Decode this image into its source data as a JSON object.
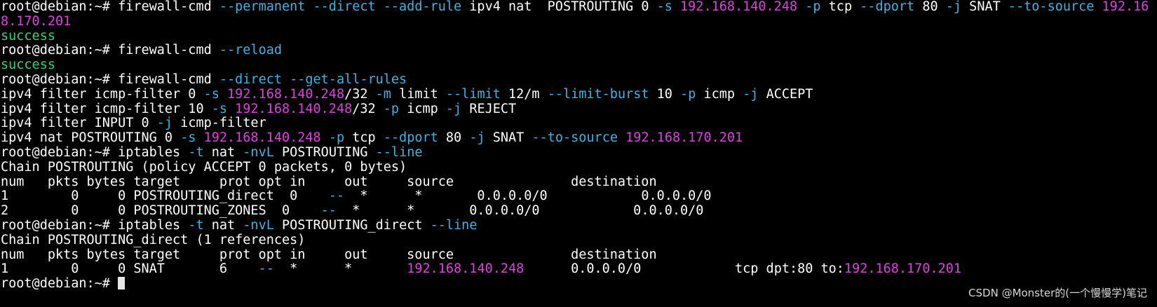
{
  "colors": {
    "background": "#000000",
    "text": "#ffffff",
    "option_flag": "#3cb4e6",
    "ip_address": "#e040e0",
    "success": "#2bd67b",
    "cursor": "#e6e6e6"
  },
  "terminal": {
    "lines": [
      {
        "kind": "command",
        "segments": [
          {
            "t": "root@debian:~# firewall-cmd ",
            "c": "n"
          },
          {
            "t": "--permanent --direct --add-rule",
            "c": "f"
          },
          {
            "t": " ipv4 nat  POSTROUTING 0 ",
            "c": "n"
          },
          {
            "t": "-s",
            "c": "f"
          },
          {
            "t": " ",
            "c": "n"
          },
          {
            "t": "192.168.140.248",
            "c": "i"
          },
          {
            "t": " ",
            "c": "n"
          },
          {
            "t": "-p",
            "c": "f"
          },
          {
            "t": " tcp ",
            "c": "n"
          },
          {
            "t": "--dport",
            "c": "f"
          },
          {
            "t": " 80 ",
            "c": "n"
          },
          {
            "t": "-j",
            "c": "f"
          },
          {
            "t": " SNAT ",
            "c": "n"
          },
          {
            "t": "--to-source",
            "c": "f"
          },
          {
            "t": " ",
            "c": "n"
          },
          {
            "t": "192.16",
            "c": "i"
          }
        ]
      },
      {
        "kind": "wrap",
        "segments": [
          {
            "t": "8.170.201",
            "c": "i"
          }
        ]
      },
      {
        "kind": "output",
        "segments": [
          {
            "t": "success",
            "c": "s"
          }
        ]
      },
      {
        "kind": "command",
        "segments": [
          {
            "t": "root@debian:~# firewall-cmd ",
            "c": "n"
          },
          {
            "t": "--reload",
            "c": "f"
          }
        ]
      },
      {
        "kind": "output",
        "segments": [
          {
            "t": "success",
            "c": "s"
          }
        ]
      },
      {
        "kind": "command",
        "segments": [
          {
            "t": "root@debian:~# firewall-cmd ",
            "c": "n"
          },
          {
            "t": "--direct --get-all-rules",
            "c": "f"
          }
        ]
      },
      {
        "kind": "output",
        "segments": [
          {
            "t": "ipv4 filter icmp-filter 0 ",
            "c": "n"
          },
          {
            "t": "-s",
            "c": "f"
          },
          {
            "t": " ",
            "c": "n"
          },
          {
            "t": "192.168.140.248",
            "c": "i"
          },
          {
            "t": "/32 ",
            "c": "n"
          },
          {
            "t": "-m",
            "c": "f"
          },
          {
            "t": " limit ",
            "c": "n"
          },
          {
            "t": "--limit",
            "c": "f"
          },
          {
            "t": " 12/m ",
            "c": "n"
          },
          {
            "t": "--limit-burst",
            "c": "f"
          },
          {
            "t": " 10 ",
            "c": "n"
          },
          {
            "t": "-p",
            "c": "f"
          },
          {
            "t": " icmp ",
            "c": "n"
          },
          {
            "t": "-j",
            "c": "f"
          },
          {
            "t": " ACCEPT",
            "c": "n"
          }
        ]
      },
      {
        "kind": "output",
        "segments": [
          {
            "t": "ipv4 filter icmp-filter 10 ",
            "c": "n"
          },
          {
            "t": "-s",
            "c": "f"
          },
          {
            "t": " ",
            "c": "n"
          },
          {
            "t": "192.168.140.248",
            "c": "i"
          },
          {
            "t": "/32 ",
            "c": "n"
          },
          {
            "t": "-p",
            "c": "f"
          },
          {
            "t": " icmp ",
            "c": "n"
          },
          {
            "t": "-j",
            "c": "f"
          },
          {
            "t": " REJECT",
            "c": "n"
          }
        ]
      },
      {
        "kind": "output",
        "segments": [
          {
            "t": "ipv4 filter INPUT 0 ",
            "c": "n"
          },
          {
            "t": "-j",
            "c": "f"
          },
          {
            "t": " icmp-filter",
            "c": "n"
          }
        ]
      },
      {
        "kind": "output",
        "segments": [
          {
            "t": "ipv4 nat POSTROUTING 0 ",
            "c": "n"
          },
          {
            "t": "-s",
            "c": "f"
          },
          {
            "t": " ",
            "c": "n"
          },
          {
            "t": "192.168.140.248",
            "c": "i"
          },
          {
            "t": " ",
            "c": "n"
          },
          {
            "t": "-p",
            "c": "f"
          },
          {
            "t": " tcp ",
            "c": "n"
          },
          {
            "t": "--dport",
            "c": "f"
          },
          {
            "t": " 80 ",
            "c": "n"
          },
          {
            "t": "-j",
            "c": "f"
          },
          {
            "t": " SNAT ",
            "c": "n"
          },
          {
            "t": "--to-source",
            "c": "f"
          },
          {
            "t": " ",
            "c": "n"
          },
          {
            "t": "192.168.170.201",
            "c": "i"
          }
        ]
      },
      {
        "kind": "command",
        "segments": [
          {
            "t": "root@debian:~# iptables ",
            "c": "n"
          },
          {
            "t": "-t",
            "c": "f"
          },
          {
            "t": " nat ",
            "c": "n"
          },
          {
            "t": "-nvL",
            "c": "f"
          },
          {
            "t": " POSTROUTING ",
            "c": "n"
          },
          {
            "t": "--line",
            "c": "f"
          }
        ]
      },
      {
        "kind": "output",
        "segments": [
          {
            "t": "Chain POSTROUTING (policy ACCEPT 0 packets, 0 bytes)",
            "c": "n"
          }
        ]
      },
      {
        "kind": "output",
        "segments": [
          {
            "t": "num   pkts bytes target     prot opt in     out     source               destination",
            "c": "n"
          }
        ]
      },
      {
        "kind": "output",
        "segments": [
          {
            "t": "1        0     0 POSTROUTING_direct  0    ",
            "c": "n"
          },
          {
            "t": "--",
            "c": "f"
          },
          {
            "t": "  *      *       0.0.0.0/0            0.0.0.0/0",
            "c": "n"
          }
        ]
      },
      {
        "kind": "output",
        "segments": [
          {
            "t": "2        0     0 POSTROUTING_ZONES  0    ",
            "c": "n"
          },
          {
            "t": "--",
            "c": "f"
          },
          {
            "t": "  *      *       0.0.0.0/0            0.0.0.0/0",
            "c": "n"
          }
        ]
      },
      {
        "kind": "command",
        "segments": [
          {
            "t": "root@debian:~# iptables ",
            "c": "n"
          },
          {
            "t": "-t",
            "c": "f"
          },
          {
            "t": " nat ",
            "c": "n"
          },
          {
            "t": "-nvL",
            "c": "f"
          },
          {
            "t": " POSTROUTING_direct ",
            "c": "n"
          },
          {
            "t": "--line",
            "c": "f"
          }
        ]
      },
      {
        "kind": "output",
        "segments": [
          {
            "t": "Chain POSTROUTING_direct (1 references)",
            "c": "n"
          }
        ]
      },
      {
        "kind": "output",
        "segments": [
          {
            "t": "num   pkts bytes target     prot opt in     out     source               destination",
            "c": "n"
          }
        ]
      },
      {
        "kind": "output",
        "segments": [
          {
            "t": "1        0     0 SNAT       6    ",
            "c": "n"
          },
          {
            "t": "--",
            "c": "f"
          },
          {
            "t": "  *      *       ",
            "c": "n"
          },
          {
            "t": "192.168.140.248",
            "c": "i"
          },
          {
            "t": "      0.0.0.0/0            tcp dpt:80 to:",
            "c": "n"
          },
          {
            "t": "192.168.170.201",
            "c": "i"
          }
        ]
      },
      {
        "kind": "prompt",
        "segments": [
          {
            "t": "root@debian:~# ",
            "c": "n"
          }
        ]
      }
    ]
  },
  "watermark": {
    "text": "CSDN @Monster的(一个慢慢学)笔记"
  }
}
